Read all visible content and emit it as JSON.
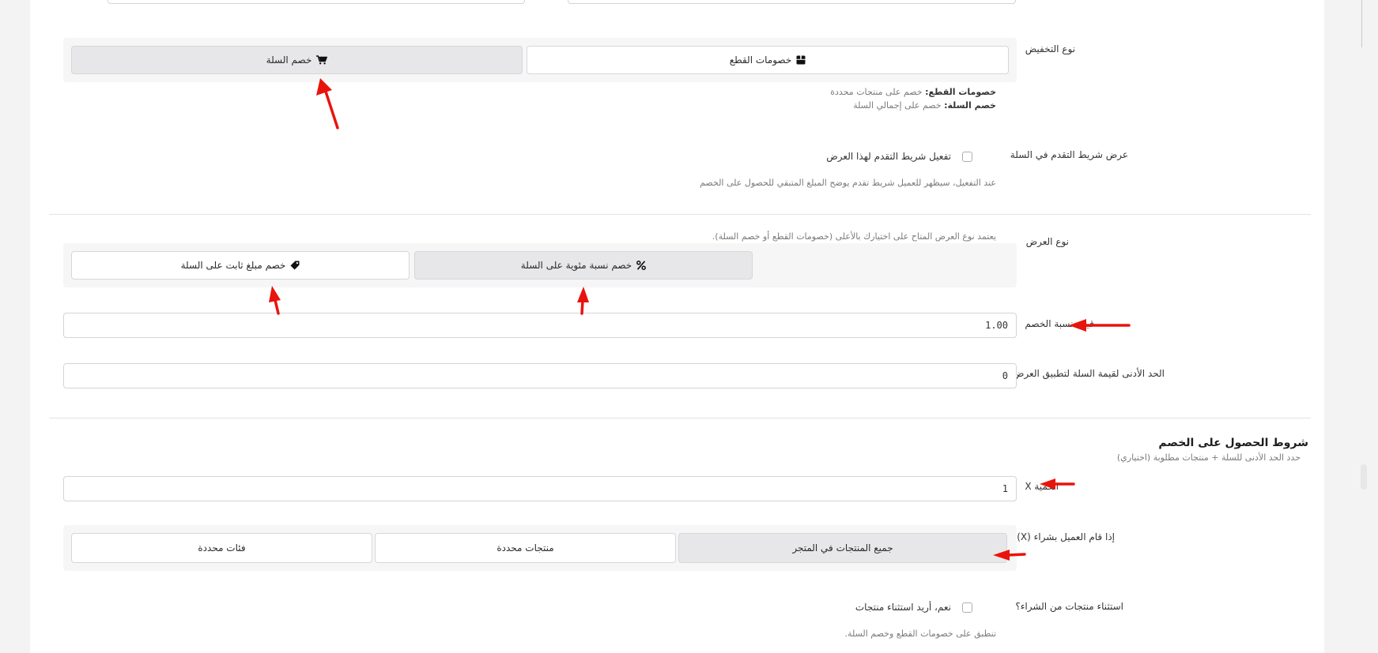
{
  "discount_type": {
    "label": "نوع التخفيض",
    "options": {
      "cart": "خصم السلة",
      "items": "خصومات القطع"
    },
    "help": {
      "items_term": "خصومات القطع:",
      "items_desc": "خصم على منتجات محددة",
      "cart_term": "خصم السلة:",
      "cart_desc": "خصم على إجمالي السلة"
    }
  },
  "progress_bar": {
    "label": "عرض شريط التقدم في السلة",
    "checkbox_label": "تفعيل شريط التقدم لهذا العرض",
    "help": "عند التفعيل، سيظهر للعميل شريط تقدم يوضح المبلغ المتبقي للحصول على الخصم"
  },
  "offer_type": {
    "label": "نوع العرض",
    "help": "يعتمد نوع العرض المتاح على اختيارك بالأعلى (خصومات القطع أو خصم السلة).",
    "options": {
      "fixed": "خصم مبلغ ثابت على السلة",
      "percent": "خصم نسبة مئوية على السلة"
    }
  },
  "discount_value": {
    "label": "قيمة نسبة الخصم",
    "value": "1.00"
  },
  "min_cart": {
    "label": "الحد الأدنى لقيمة السلة لتطبيق العرض",
    "value": "0"
  },
  "conditions": {
    "title": "شروط الحصول على الخصم",
    "subtitle": "حدد الحد الأدنى للسلة + منتجات مطلوبة (اختياري)"
  },
  "quantity": {
    "label": "الكمية X",
    "value": "1"
  },
  "purchase_scope": {
    "label": "إذا قام العميل بشراء (X)",
    "options": {
      "categories": "فئات محددة",
      "products": "منتجات محددة",
      "all": "جميع المنتجات في المتجر"
    }
  },
  "exclude": {
    "label": "استثناء منتجات من الشراء؟",
    "checkbox_label": "نعم، أريد استثناء منتجات",
    "help": "تنطبق على خصومات القطع وخصم السلة."
  },
  "colors": {
    "annotation_arrow": "#e8140c",
    "active_segment": "#e7e7e9",
    "panel": "#f6f6f7"
  },
  "icons": {
    "cart": "cart-icon",
    "box": "box-icon",
    "tag": "tag-icon",
    "percent": "percent-icon"
  }
}
